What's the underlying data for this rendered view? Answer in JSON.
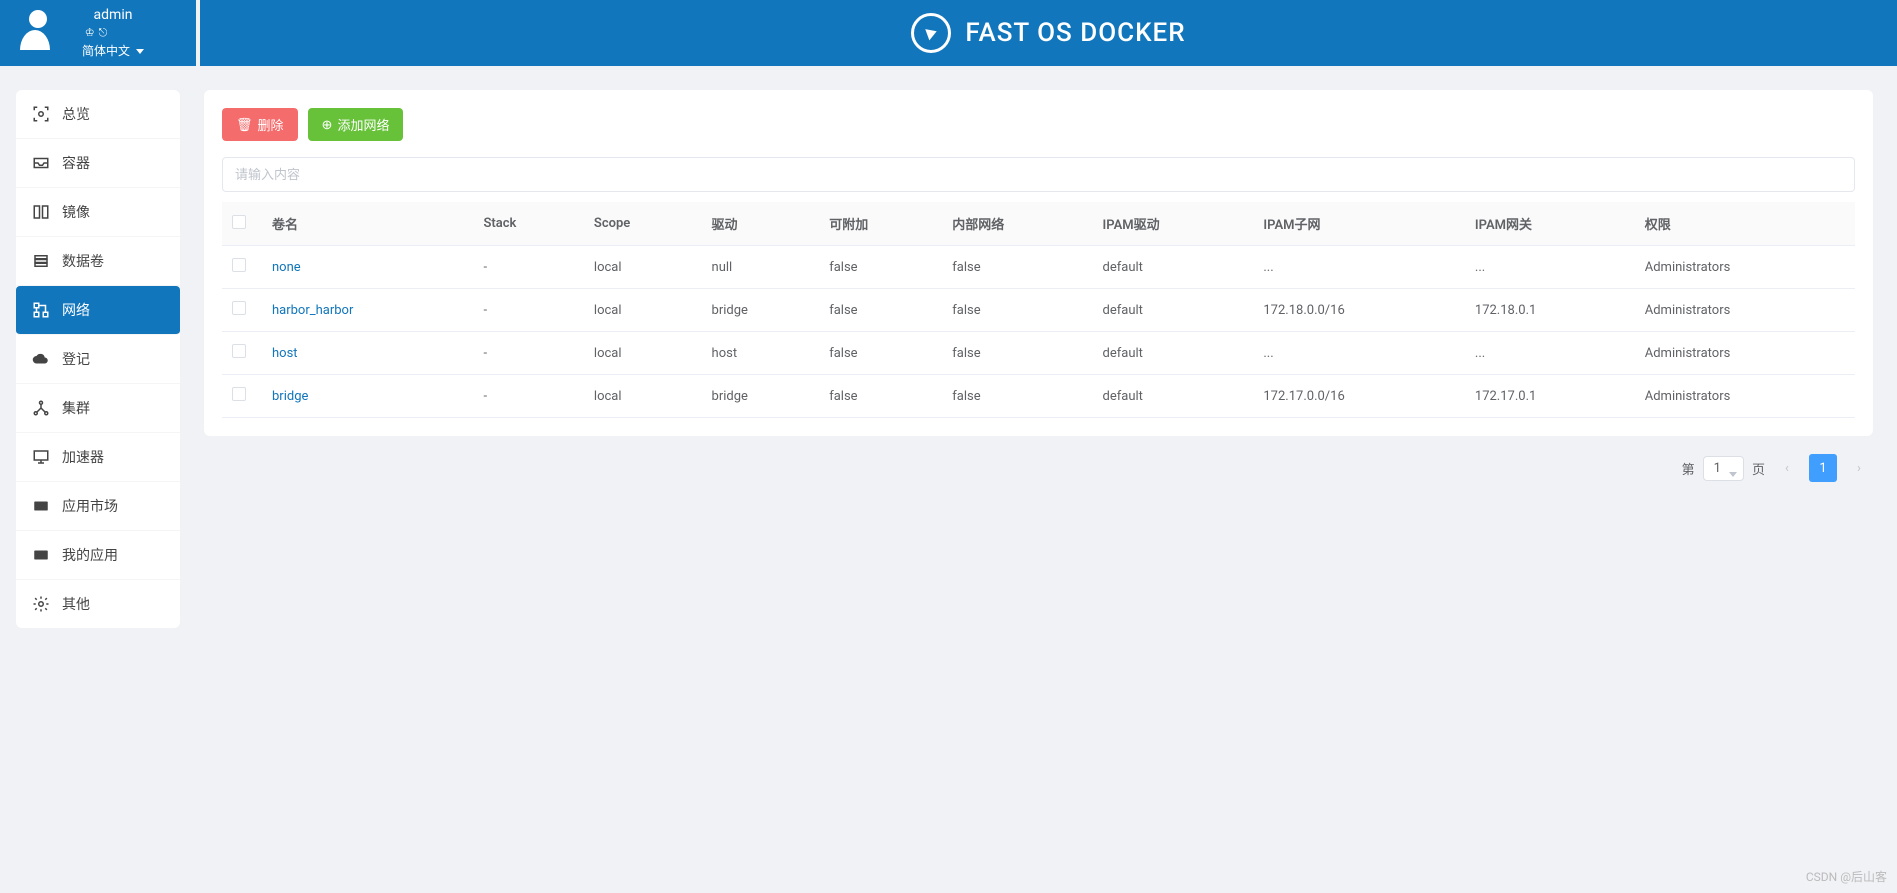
{
  "header": {
    "username": "admin",
    "language": "简体中文",
    "app_title": "FAST OS DOCKER"
  },
  "sidebar": {
    "items": [
      {
        "label": "总览",
        "icon": "scan"
      },
      {
        "label": "容器",
        "icon": "inbox"
      },
      {
        "label": "镜像",
        "icon": "mirror"
      },
      {
        "label": "数据卷",
        "icon": "database"
      },
      {
        "label": "网络",
        "icon": "network",
        "active": true
      },
      {
        "label": "登记",
        "icon": "cloud"
      },
      {
        "label": "集群",
        "icon": "cluster"
      },
      {
        "label": "加速器",
        "icon": "monitor"
      },
      {
        "label": "应用市场",
        "icon": "app"
      },
      {
        "label": "我的应用",
        "icon": "myapp"
      },
      {
        "label": "其他",
        "icon": "gear"
      }
    ]
  },
  "toolbar": {
    "delete_label": "删除",
    "add_label": "添加网络"
  },
  "search": {
    "placeholder": "请输入内容"
  },
  "table": {
    "headers": [
      "卷名",
      "Stack",
      "Scope",
      "驱动",
      "可附加",
      "内部网络",
      "IPAM驱动",
      "IPAM子网",
      "IPAM网关",
      "权限"
    ],
    "rows": [
      {
        "name": "none",
        "stack": "-",
        "scope": "local",
        "driver": "null",
        "attachable": "false",
        "internal": "false",
        "ipam_driver": "default",
        "ipam_subnet": "...",
        "ipam_gateway": "...",
        "perm": "Administrators"
      },
      {
        "name": "harbor_harbor",
        "stack": "-",
        "scope": "local",
        "driver": "bridge",
        "attachable": "false",
        "internal": "false",
        "ipam_driver": "default",
        "ipam_subnet": "172.18.0.0/16",
        "ipam_gateway": "172.18.0.1",
        "perm": "Administrators"
      },
      {
        "name": "host",
        "stack": "-",
        "scope": "local",
        "driver": "host",
        "attachable": "false",
        "internal": "false",
        "ipam_driver": "default",
        "ipam_subnet": "...",
        "ipam_gateway": "...",
        "perm": "Administrators"
      },
      {
        "name": "bridge",
        "stack": "-",
        "scope": "local",
        "driver": "bridge",
        "attachable": "false",
        "internal": "false",
        "ipam_driver": "default",
        "ipam_subnet": "172.17.0.0/16",
        "ipam_gateway": "172.17.0.1",
        "perm": "Administrators"
      }
    ]
  },
  "pager": {
    "prefix": "第",
    "suffix": "页",
    "current": "1",
    "page_number": "1"
  },
  "watermark": "CSDN @后山客"
}
